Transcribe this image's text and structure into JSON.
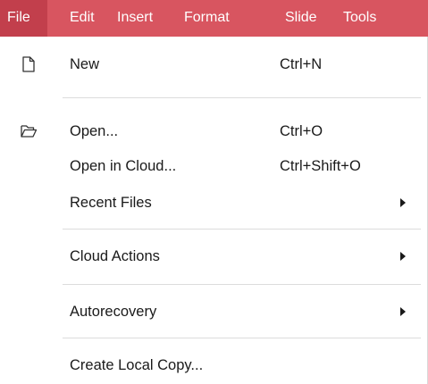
{
  "menubar": {
    "tabs": [
      {
        "label": "File",
        "active": true
      },
      {
        "label": "Edit"
      },
      {
        "label": "Insert"
      },
      {
        "label": "Format"
      },
      {
        "label": "Slide"
      },
      {
        "label": "Tools"
      }
    ]
  },
  "file_menu": {
    "items": [
      {
        "label": "New",
        "shortcut": "Ctrl+N",
        "icon": "new-document-icon"
      },
      {
        "label": "Open...",
        "shortcut": "Ctrl+O",
        "icon": "open-folder-icon"
      },
      {
        "label": "Open in Cloud...",
        "shortcut": "Ctrl+Shift+O"
      },
      {
        "label": "Recent Files",
        "submenu": true
      },
      {
        "label": "Cloud Actions",
        "submenu": true
      },
      {
        "label": "Autorecovery",
        "submenu": true
      },
      {
        "label": "Create Local Copy..."
      }
    ]
  },
  "colors": {
    "menubar_bg": "#d85560",
    "active_tab_bg": "#c23f4c",
    "menubar_text": "#ffffff"
  }
}
